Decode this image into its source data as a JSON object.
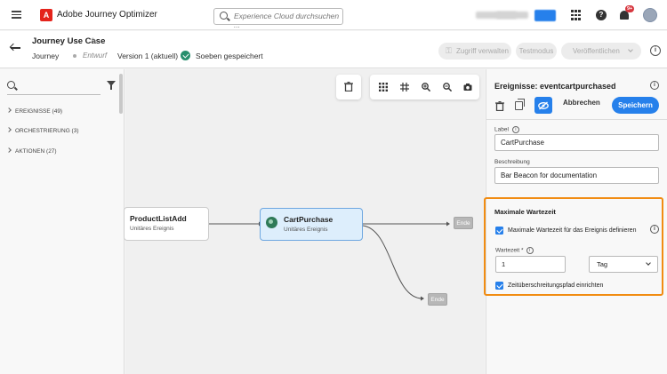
{
  "shell": {
    "app_name": "Adobe Journey Optimizer",
    "search_placeholder": "Experience Cloud durchsuchen ...",
    "logo_text": "A",
    "help_glyph": "?",
    "notification_count": "9+"
  },
  "journey": {
    "title": "Journey Use Case",
    "type": "Journey",
    "status": "Entwurf",
    "version": "Version 1 (aktuell)",
    "save_status": "Soeben gespeichert",
    "buttons": {
      "access": "Zugriff verwalten",
      "test_mode": "Testmodus",
      "publish": "Veröffentlichen",
      "info": "i"
    }
  },
  "left_panel": {
    "categories": [
      {
        "label": "EREIGNISSE (49)"
      },
      {
        "label": "ORCHESTRIERUNG (3)"
      },
      {
        "label": "AKTIONEN (27)"
      }
    ]
  },
  "canvas": {
    "nodes": [
      {
        "title": "ProductListAdd",
        "subtitle": "Unitäres Ereignis"
      },
      {
        "title": "CartPurchase",
        "subtitle": "Unitäres Ereignis",
        "selected": true
      }
    ],
    "end_label": "Ende"
  },
  "right_panel": {
    "title": "Ereignisse: eventcartpurchased",
    "info_glyph": "i",
    "cancel_label": "Abbrechen",
    "save_label": "Speichern",
    "label_field": {
      "label": "Label",
      "value": "CartPurchase"
    },
    "description_field": {
      "label": "Beschreibung",
      "value": "Bar Beacon for documentation"
    },
    "max_wait": {
      "title": "Maximale Wartezeit",
      "define_checkbox_label": "Maximale Wartezeit für das Ereignis definieren",
      "define_checked": true,
      "wait_label": "Wartezeit",
      "required_marker": "*",
      "wait_value": "1",
      "unit": "Tag",
      "timeout_checkbox_label": "Zeitüberschreitungspfad einrichten",
      "timeout_checked": true
    }
  },
  "colors": {
    "accent": "#2680eb",
    "highlight_border": "#f18c12",
    "brand_red": "#e4231b",
    "success": "#268e6c"
  }
}
